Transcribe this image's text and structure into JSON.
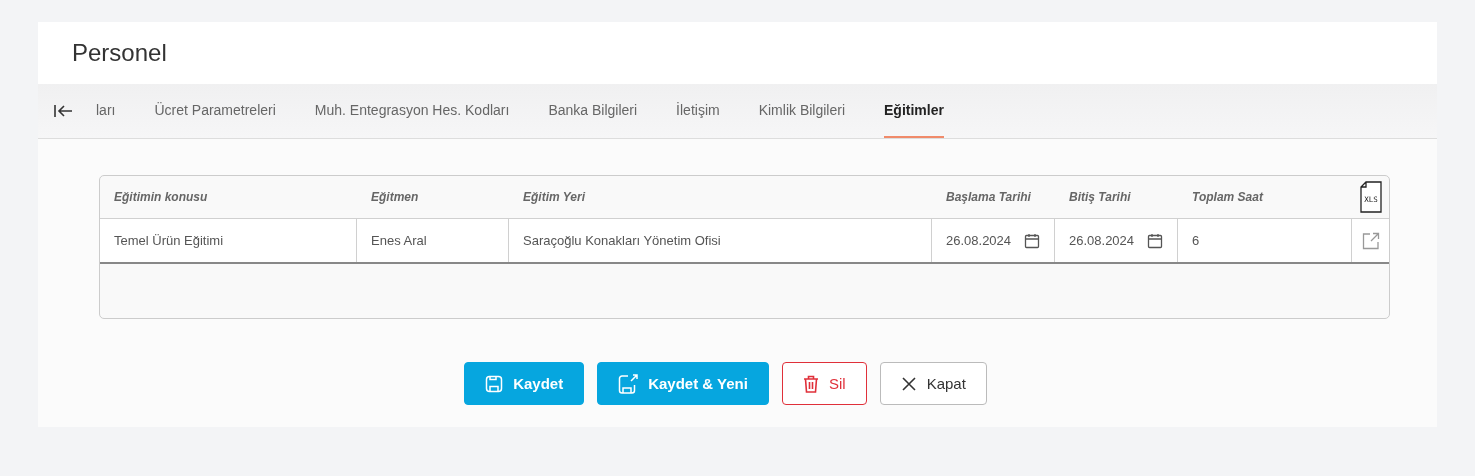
{
  "title": "Personel",
  "tabs": [
    {
      "label": "ları",
      "selected": false
    },
    {
      "label": "Ücret Parametreleri",
      "selected": false
    },
    {
      "label": "Muh. Entegrasyon Hes. Kodları",
      "selected": false
    },
    {
      "label": "Banka Bilgileri",
      "selected": false
    },
    {
      "label": "İletişim",
      "selected": false
    },
    {
      "label": "Kimlik Bilgileri",
      "selected": false
    },
    {
      "label": "Eğitimler",
      "selected": true
    }
  ],
  "table": {
    "columns": [
      "Eğitimin konusu",
      "Eğitmen",
      "Eğitim Yeri",
      "Başlama Tarihi",
      "Bitiş Tarihi",
      "Toplam Saat"
    ],
    "export_label": "XLS",
    "rows": [
      {
        "cells": [
          {
            "kind": "text",
            "value": "Temel Ürün Eğitimi"
          },
          {
            "kind": "text",
            "value": "Enes Aral"
          },
          {
            "kind": "text",
            "value": "Saraçoğlu Konakları Yönetim Ofisi"
          },
          {
            "kind": "date",
            "value": "26.08.2024"
          },
          {
            "kind": "date",
            "value": "26.08.2024"
          },
          {
            "kind": "text",
            "value": "6"
          }
        ]
      }
    ]
  },
  "buttons": [
    {
      "kind": "save",
      "label": "Kaydet"
    },
    {
      "kind": "save-new",
      "label": "Kaydet & Yeni"
    },
    {
      "kind": "delete",
      "label": "Sil"
    },
    {
      "kind": "close",
      "label": "Kapat"
    }
  ]
}
